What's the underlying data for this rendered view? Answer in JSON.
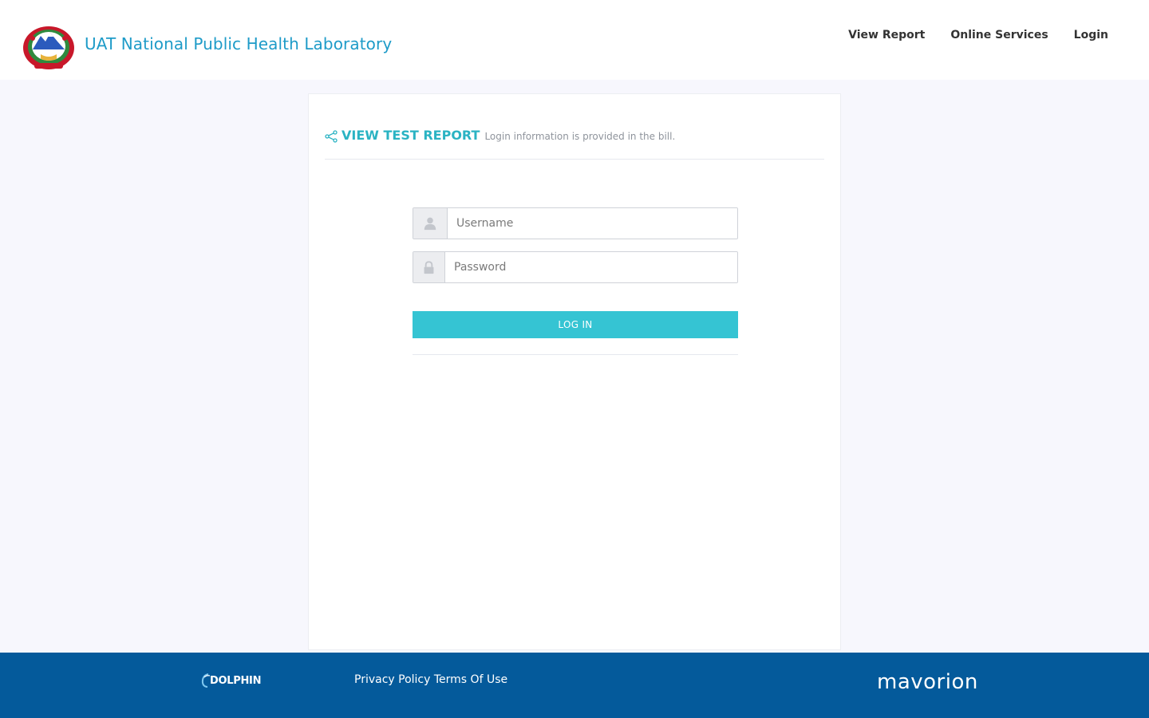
{
  "header": {
    "brand_title": "UAT National Public Health Laboratory",
    "nav": [
      {
        "label": "View Report"
      },
      {
        "label": "Online Services"
      },
      {
        "label": "Login"
      }
    ]
  },
  "card": {
    "title": "VIEW TEST REPORT",
    "subtitle": "Login information is provided in the bill.",
    "username_placeholder": "Username",
    "password_placeholder": "Password",
    "login_label": "LOG IN",
    "user_icon": "user-icon",
    "lock_icon": "lock-icon",
    "share_icon": "share-icon"
  },
  "footer": {
    "dolphin_logo": "DOLPHIN",
    "privacy_label": "Privacy Policy",
    "terms_label": "Terms Of Use",
    "mavorion_logo": "mavorion"
  },
  "colors": {
    "brand": "#1e9bc8",
    "accent": "#35c4d3",
    "footer_bg": "#045a9b",
    "page_bg": "#f7f7fd"
  }
}
